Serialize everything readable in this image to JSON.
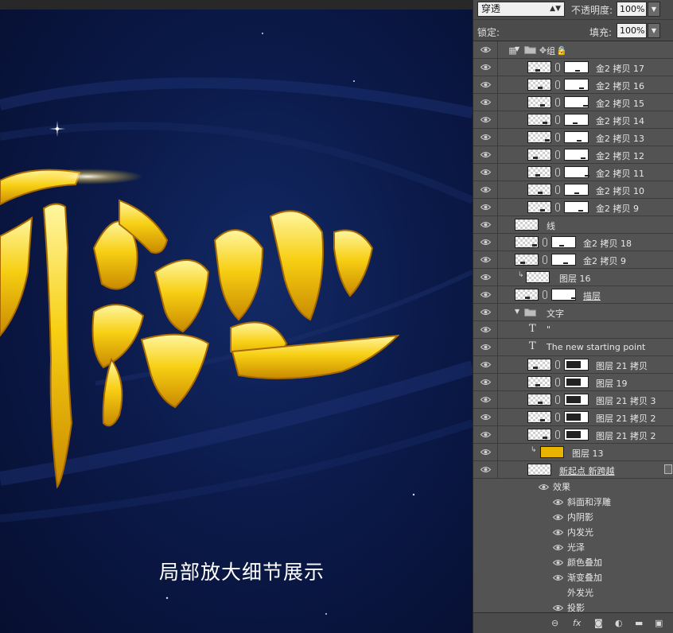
{
  "canvas": {
    "headline": "新跨越",
    "caption": "局部放大细节展示"
  },
  "panel": {
    "blend_mode": "穿透",
    "opacity_label": "不透明度:",
    "opacity_value": "100%",
    "lock_label": "锁定:",
    "fill_label": "填充:",
    "fill_value": "100%"
  },
  "layers": [
    {
      "name": "组 2",
      "kind": "group"
    },
    {
      "name": "金2 拷贝 17",
      "kind": "masked"
    },
    {
      "name": "金2 拷贝 16",
      "kind": "masked"
    },
    {
      "name": "金2 拷贝 15",
      "kind": "masked"
    },
    {
      "name": "金2 拷贝 14",
      "kind": "masked"
    },
    {
      "name": "金2 拷贝 13",
      "kind": "masked"
    },
    {
      "name": "金2 拷贝 12",
      "kind": "masked"
    },
    {
      "name": "金2 拷贝 11",
      "kind": "masked"
    },
    {
      "name": "金2 拷贝 10",
      "kind": "masked"
    },
    {
      "name": "金2 拷贝 9",
      "kind": "masked"
    },
    {
      "name": "线",
      "kind": "plain"
    },
    {
      "name": "金2 拷贝 18",
      "kind": "masked"
    },
    {
      "name": "金2 拷贝 9",
      "kind": "masked"
    },
    {
      "name": "图层 16",
      "kind": "clipped"
    },
    {
      "name": "描层",
      "kind": "masked-underline"
    },
    {
      "name": "文字",
      "kind": "group"
    },
    {
      "name": "\"",
      "kind": "text"
    },
    {
      "name": "The new    starting point",
      "kind": "text"
    },
    {
      "name": "图层 21 拷贝",
      "kind": "masked"
    },
    {
      "name": "图层 19",
      "kind": "masked"
    },
    {
      "name": "图层 21 拷贝 3",
      "kind": "masked"
    },
    {
      "name": "图层 21 拷贝 2",
      "kind": "masked"
    },
    {
      "name": "图层 21 拷贝 2",
      "kind": "masked"
    },
    {
      "name": "图层 13",
      "kind": "clipped-gold"
    },
    {
      "name": "新起点 新跨越",
      "kind": "fx-layer"
    }
  ],
  "effects": {
    "header": "效果",
    "items": [
      {
        "name": "斜面和浮雕",
        "visible": true
      },
      {
        "name": "内阴影",
        "visible": true
      },
      {
        "name": "内发光",
        "visible": true
      },
      {
        "name": "光泽",
        "visible": true
      },
      {
        "name": "颜色叠加",
        "visible": true
      },
      {
        "name": "渐变叠加",
        "visible": true
      },
      {
        "name": "外发光",
        "visible": false
      },
      {
        "name": "投影",
        "visible": true
      }
    ]
  },
  "bottom_bar": {
    "fx_label": "fx"
  },
  "colors": {
    "panel_bg": "#535353",
    "canvas_bg": "#0b1a4a",
    "gold": "#f5c400"
  }
}
